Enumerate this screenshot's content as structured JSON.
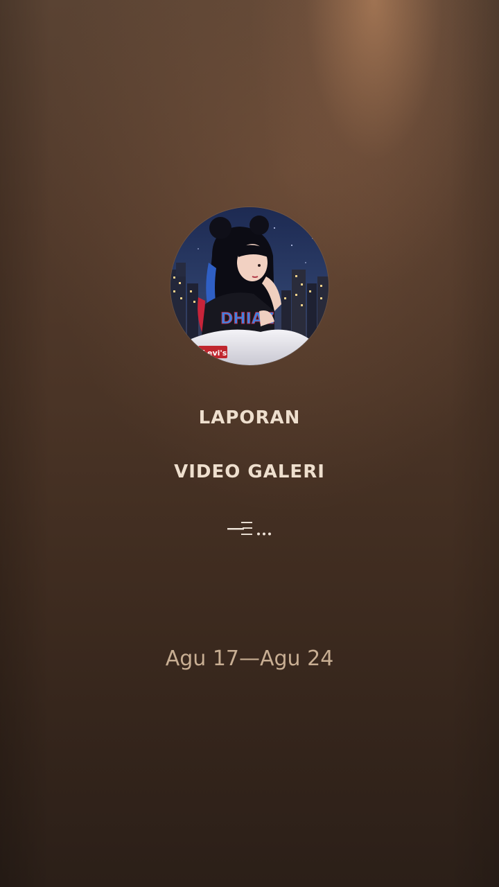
{
  "screen": {
    "profile_image": "profile-avatar-image",
    "title_primary": "LAPORAN",
    "title_secondary": "VIDEO GALERI",
    "loading_icon": "loading-dots-icon",
    "date_range": "Agu 17—Agu 24"
  },
  "colors": {
    "title_text": "#eedfce",
    "date_text": "#c8ae93",
    "background_top": "#5a4333",
    "background_bottom": "#2b1f18"
  }
}
